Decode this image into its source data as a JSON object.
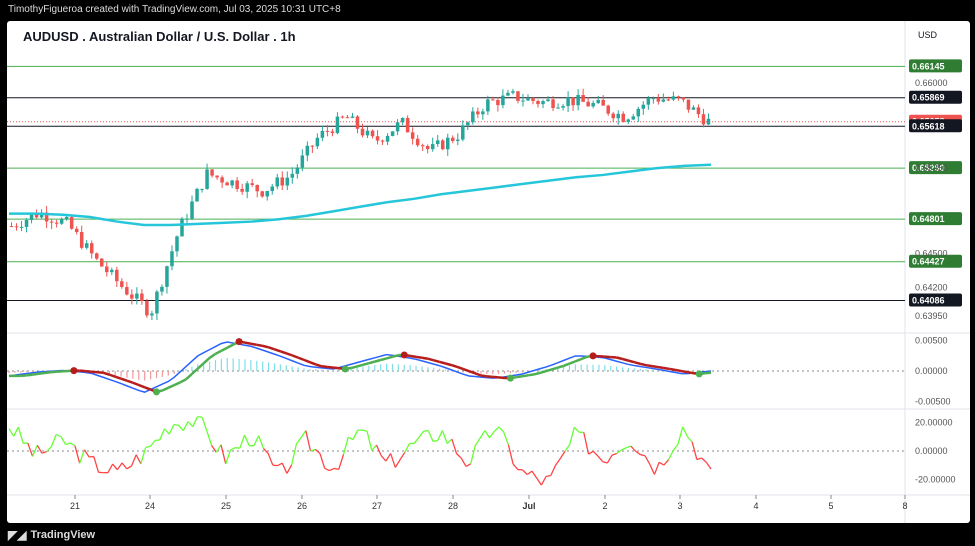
{
  "header": {
    "author_line": "TimothyFigueroa created with TradingView.com, Jul 03, 2025 10:31 UTC+8"
  },
  "footer": {
    "brand": "TradingView"
  },
  "chart": {
    "title": "AUDUSD . Australian Dollar / U.S. Dollar . 1h",
    "currency": "USD"
  },
  "colors": {
    "up": "#26a69a",
    "down": "#ef5350",
    "ma": "#26c6da",
    "green_line": "#4caf50",
    "osc_fast": "#2962ff",
    "osc_slow_up": "#4caf50",
    "osc_slow_down": "#b71c1c",
    "rsi_up": "#66ff33",
    "rsi_down": "#ff4444"
  },
  "chart_data": [
    {
      "type": "candlestick",
      "title": "AUDUSD . Australian Dollar / U.S. Dollar . 1h",
      "x": [
        "21",
        "24",
        "25",
        "26",
        "27",
        "28",
        "Jul",
        "2",
        "3",
        "4",
        "5",
        "8"
      ],
      "price_axis_ticks": [
        "0.66000",
        "0.65250",
        "0.64500",
        "0.64200",
        "0.63950"
      ],
      "price_range": [
        0.638,
        0.6628
      ],
      "horizontal_levels": [
        {
          "value": "0.66145",
          "style": "green"
        },
        {
          "value": "0.65869",
          "style": "black"
        },
        {
          "value": "0.65658",
          "style": "current"
        },
        {
          "value": "0.65618",
          "style": "black"
        },
        {
          "value": "0.65250",
          "style": "green"
        },
        {
          "value": "0.64801",
          "style": "green"
        },
        {
          "value": "0.64427",
          "style": "green"
        },
        {
          "value": "0.64086",
          "style": "black"
        }
      ],
      "moving_average": [
        0.6485,
        0.6485,
        0.6484,
        0.6482,
        0.6478,
        0.6475,
        0.6475,
        0.6476,
        0.6477,
        0.6478,
        0.648,
        0.6483,
        0.6487,
        0.6491,
        0.6495,
        0.6498,
        0.6502,
        0.6505,
        0.6508,
        0.6511,
        0.6514,
        0.6517,
        0.6519,
        0.6522,
        0.6525,
        0.6527,
        0.6528
      ],
      "close_approx": [
        0.6474,
        0.6486,
        0.6476,
        0.6445,
        0.642,
        0.6398,
        0.647,
        0.652,
        0.6512,
        0.6505,
        0.6518,
        0.6552,
        0.657,
        0.6548,
        0.6565,
        0.654,
        0.6554,
        0.6582,
        0.6588,
        0.6583,
        0.6585,
        0.658,
        0.657,
        0.6587,
        0.6584,
        0.6566
      ]
    },
    {
      "type": "line",
      "title": "",
      "y_ticks": [
        "0.00500",
        "0.00000",
        "-0.00500"
      ],
      "series": [
        {
          "values": [
            -0.0008,
            -0.0002,
            0.0001,
            -0.0003,
            -0.0018,
            -0.0035,
            -0.0015,
            0.0025,
            0.0048,
            0.004,
            0.0025,
            0.0008,
            0.0003,
            0.0015,
            0.0027,
            0.002,
            0.0008,
            -0.0008,
            -0.0012,
            -0.0005,
            0.0008,
            0.0025,
            0.0022,
            0.001,
            0.0003,
            -0.0005,
            0.0
          ]
        }
      ]
    },
    {
      "type": "line",
      "title": "",
      "y_ticks": [
        "20.00000",
        "0.00000",
        "-20.00000"
      ],
      "series": [
        {
          "values": [
            18,
            -3,
            8,
            -8,
            -15,
            -2,
            20,
            22,
            -5,
            12,
            -18,
            8,
            -12,
            15,
            -10,
            5,
            14,
            -8,
            18,
            -15,
            -22,
            12,
            -5,
            10,
            -12,
            18,
            -18
          ]
        }
      ]
    }
  ]
}
